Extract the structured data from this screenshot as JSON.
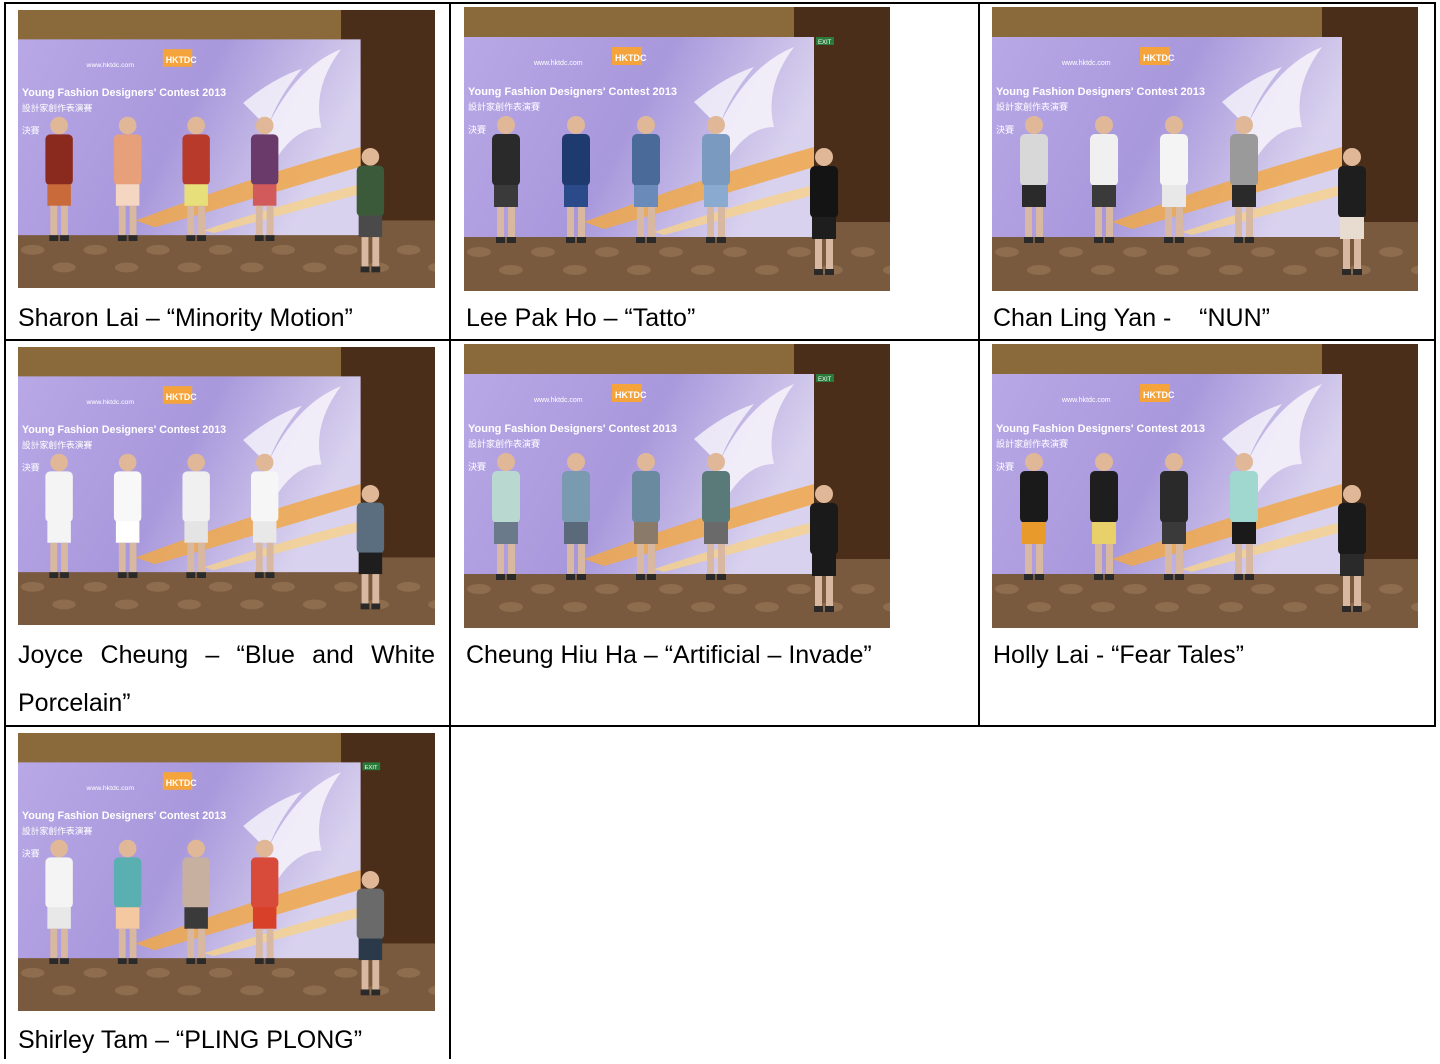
{
  "banner": {
    "site": "www.hktdc.com",
    "logo": "HKTDC",
    "title": "Young Fashion Designers' Contest 2013",
    "title_cn": "設計家創作表演賽",
    "stage": "決賽",
    "exit": "EXIT"
  },
  "cells": [
    {
      "caption": "Sharon Lai – “Minority Motion”"
    },
    {
      "caption": "Lee Pak Ho – “Tatto”"
    },
    {
      "caption": "Chan Ling Yan -    “NUN”"
    },
    {
      "caption": "Joyce Cheung – “Blue and White Porcelain”"
    },
    {
      "caption": "Cheung Hiu Ha – “Artificial – Invade”"
    },
    {
      "caption": "Holly Lai - “Fear Tales”"
    },
    {
      "caption": "Shirley Tam – “PLING PLONG”"
    }
  ]
}
